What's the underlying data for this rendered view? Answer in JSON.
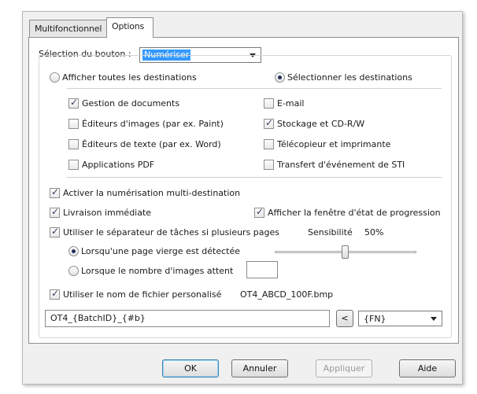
{
  "tabs": [
    {
      "label": "Multifonctionnel",
      "active": false
    },
    {
      "label": "Options",
      "active": true
    }
  ],
  "button_selection": {
    "label": "Sélection du bouton :",
    "value": "Numériser"
  },
  "destinations": {
    "show_all_label": "Afficher toutes les destinations",
    "select_label": "Sélectionner les destinations",
    "selected_mode": "select",
    "items": [
      {
        "label": "Gestion de documents",
        "checked": true
      },
      {
        "label": "E-mail",
        "checked": false
      },
      {
        "label": "Éditeurs d'images (par ex. Paint)",
        "checked": false
      },
      {
        "label": "Stockage et CD-R/W",
        "checked": true
      },
      {
        "label": "Éditeurs de texte (par ex. Word)",
        "checked": false
      },
      {
        "label": "Télécopieur et imprimante",
        "checked": false
      },
      {
        "label": "Applications PDF",
        "checked": false
      },
      {
        "label": "Transfert d'événement de STI",
        "checked": false
      }
    ]
  },
  "options": {
    "multi_dest": {
      "label": "Activer la numérisation multi-destination",
      "checked": true
    },
    "instant_delivery": {
      "label": "Livraison immédiate",
      "checked": true
    },
    "show_progress": {
      "label": "Afficher la fenêtre d'état de progression",
      "checked": true
    },
    "job_separator": {
      "label": "Utiliser le séparateur de tâches si plusieurs pages",
      "checked": true
    },
    "sensitivity_label": "Sensibilité",
    "sensitivity_value": "50%",
    "sensitivity_level": 0.5,
    "blank_page_label": "Lorsqu'une page vierge est détectée",
    "image_count_label": "Lorsque le nombre d'images attent",
    "image_count_value": "",
    "separator_mode": "blank_page",
    "custom_filename": {
      "label": "Utiliser le nom de fichier personalisé",
      "checked": true
    },
    "filename_preview": "OT4_ABCD_100F.bmp",
    "filename_pattern": "OT4_{BatchID}_{#b}",
    "insert_button_label": "<",
    "token_value": "{FN}"
  },
  "buttons": {
    "ok": "OK",
    "cancel": "Annuler",
    "apply": "Appliquer",
    "help": "Aide"
  },
  "colors": {
    "selection": "#3399ff",
    "dialog_bg": "#f0f0f0",
    "default_button_border": "#3c7fb1"
  }
}
